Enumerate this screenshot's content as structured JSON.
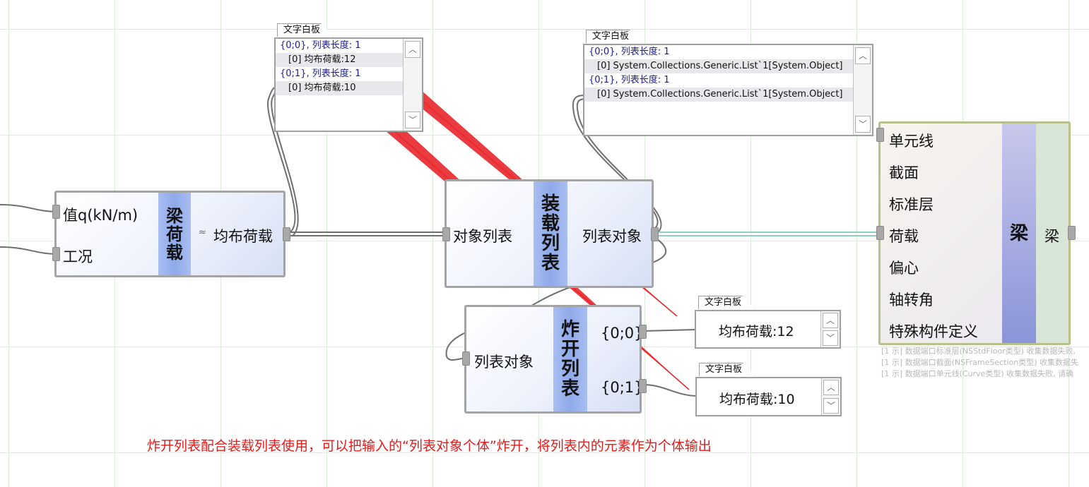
{
  "components": {
    "beam_load": {
      "inputs": [
        "值q(kN/m)",
        "工况"
      ],
      "title": "梁荷载",
      "output_prefix": "≈",
      "output": "均布荷载"
    },
    "load_list": {
      "input": "对象列表",
      "title": "装载列表",
      "output": "列表对象"
    },
    "explode_list": {
      "input": "列表对象",
      "title": "炸开列表",
      "outputs": [
        "{0;0}",
        "{0;1}"
      ]
    },
    "beam": {
      "inputs": [
        "单元线",
        "截面",
        "标准层",
        "荷载",
        "偏心",
        "轴转角",
        "特殊构件定义"
      ],
      "title": "梁",
      "output": "梁"
    }
  },
  "panels": {
    "panel1": {
      "tab": "文字白板",
      "rows": [
        "{0;0}, 列表长度: 1",
        "[0]  均布荷载:12",
        "{0;1}, 列表长度: 1",
        "[0]  均布荷载:10"
      ]
    },
    "panel2": {
      "tab": "文字白板",
      "rows": [
        "{0;0}, 列表长度: 1",
        "[0]  System.Collections.Generic.List`1[System.Object]",
        "{0;1}, 列表长度: 1",
        "[0]  System.Collections.Generic.List`1[System.Object]"
      ]
    },
    "panel3": {
      "tab": "文字白板",
      "value": "均布荷载:12"
    },
    "panel4": {
      "tab": "文字白板",
      "value": "均布荷载:10"
    }
  },
  "ghost_messages": [
    "[1 示] 数据端口标准层(NSStdFloor类型) 收集数据失败,",
    "[1 示] 数据端口截面(NSFrameSection类型) 收集数据失",
    "[1 示] 数据端口单元线(Curve类型) 收集数据失败, 请确"
  ],
  "annotation": "炸开列表配合装载列表使用，可以把输入的“列表对象个体”炸开，将列表内的元素作为个体输出",
  "colors": {
    "arrow": "#e8262b",
    "annotation": "#e41b1b",
    "component_center": "#8fa9ea",
    "beam_center": "#8a94d8",
    "wire": "#6f6f6f"
  }
}
